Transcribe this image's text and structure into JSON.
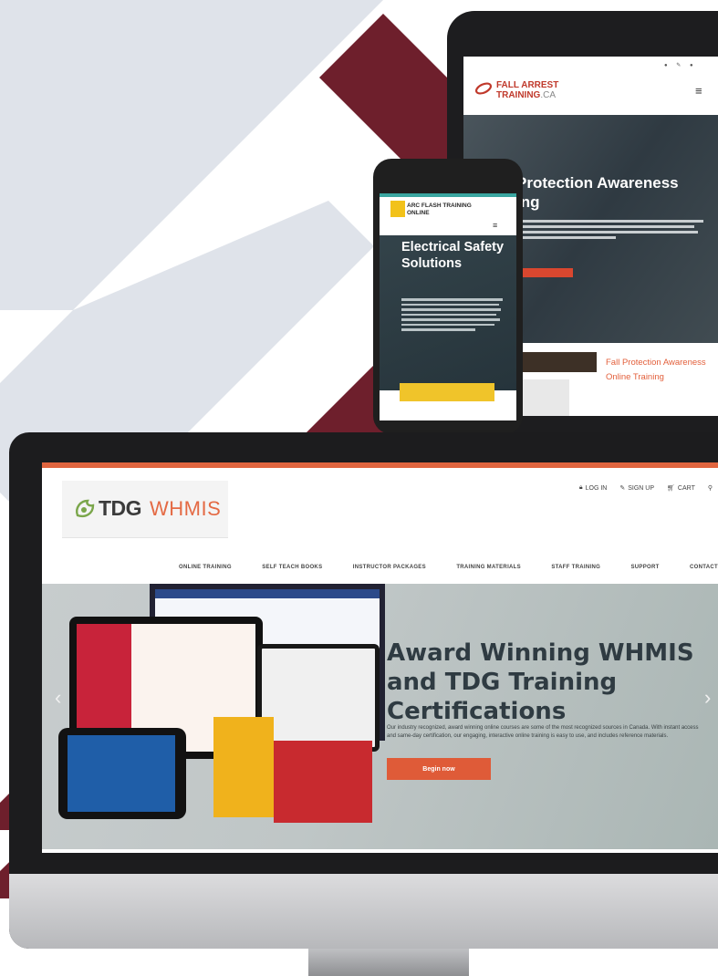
{
  "colors": {
    "accent_orange": "#e0653f",
    "maroon": "#6e1f2c",
    "slate": "#dfe3ea",
    "cta_yellow": "#f0c42a"
  },
  "desktop": {
    "toplinks": [
      {
        "icon": "lock-icon",
        "label": "LOG IN"
      },
      {
        "icon": "pencil-icon",
        "label": "SIGN UP"
      },
      {
        "icon": "cart-icon",
        "label": "CART"
      }
    ],
    "search_icon": "search-icon",
    "logo": {
      "bold": "TDG",
      "light": "WHMIS"
    },
    "nav": [
      "ONLINE TRAINING",
      "SELF TEACH BOOKS",
      "INSTRUCTOR PACKAGES",
      "TRAINING MATERIALS",
      "STAFF TRAINING",
      "SUPPORT",
      "CONTACT"
    ],
    "hero": {
      "title": "Award Winning WHMIS and TDG Training Certifications",
      "body": "Our industry recognized, award winning online courses are some of the most recognized sources in Canada. With instant access and same-day certification, our engaging, interactive online training is easy to use, and includes reference materials.",
      "button": "Begin now"
    }
  },
  "tablet": {
    "logo_line1": "FALL ARREST",
    "logo_line2": "TRAINING",
    "logo_suffix": ".CA",
    "hero_title_1": "Protection Awareness",
    "hero_title_2": "ing",
    "card_link": "Fall Protection Awareness Online Training"
  },
  "phone": {
    "logo_line1": "ARC FLASH TRAINING",
    "logo_line2": "ONLINE",
    "hero_title": "Electrical Safety Solutions"
  }
}
